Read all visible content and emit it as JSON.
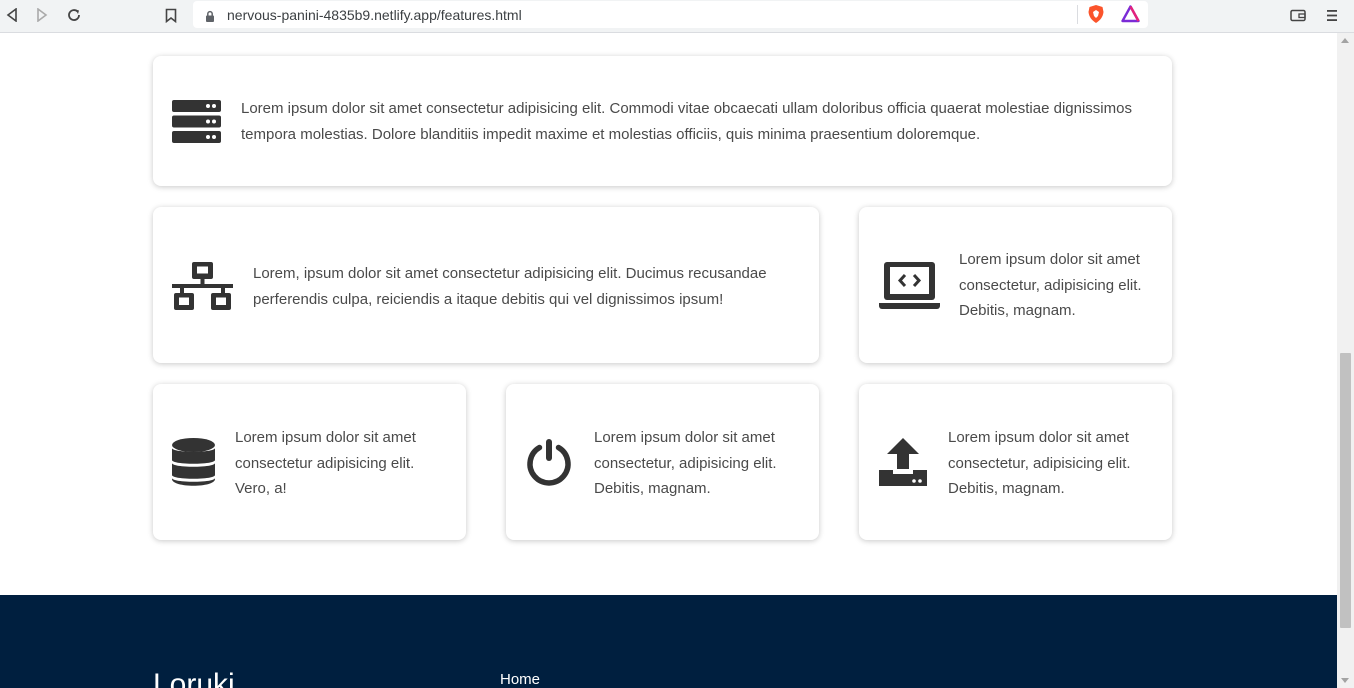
{
  "browser": {
    "url": "nervous-panini-4835b9.netlify.app/features.html"
  },
  "cards": [
    {
      "icon": "server-icon",
      "text": "Lorem ipsum dolor sit amet consectetur adipisicing elit. Commodi vitae obcaecati ullam doloribus officia quaerat molestiae dignissimos tempora molestias. Dolore blanditiis impedit maxime et molestias officiis, quis minima praesentium doloremque."
    },
    {
      "icon": "network-icon",
      "text": "Lorem, ipsum dolor sit amet consectetur adipisicing elit. Ducimus recusandae perferendis culpa, reiciendis a itaque debitis qui vel dignissimos ipsum!"
    },
    {
      "icon": "laptop-code-icon",
      "text": "Lorem ipsum dolor sit amet consectetur, adipisicing elit. Debitis, magnam."
    },
    {
      "icon": "database-icon",
      "text": "Lorem ipsum dolor sit amet consectetur adipisicing elit. Vero, a!"
    },
    {
      "icon": "power-icon",
      "text": "Lorem ipsum dolor sit amet consectetur, adipisicing elit. Debitis, magnam."
    },
    {
      "icon": "upload-icon",
      "text": "Lorem ipsum dolor sit amet consectetur, adipisicing elit. Debitis, magnam."
    }
  ],
  "footer": {
    "brand": "Loruki",
    "links": [
      "Home"
    ]
  },
  "colors": {
    "footer_bg": "#001f3f",
    "icon": "#333333"
  }
}
